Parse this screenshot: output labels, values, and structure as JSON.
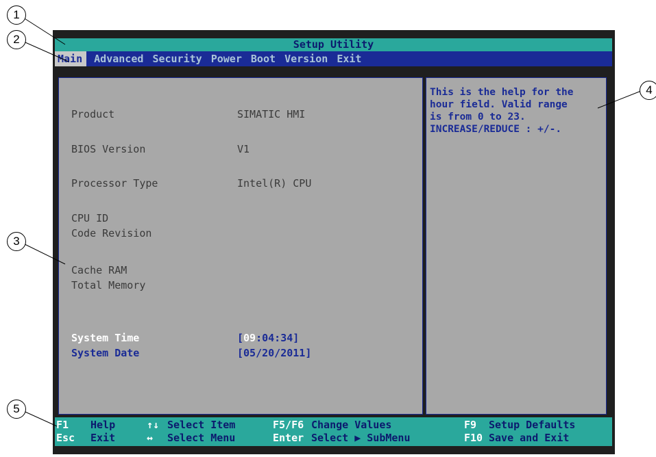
{
  "callouts": [
    "1",
    "2",
    "3",
    "4",
    "5"
  ],
  "title": "Setup Utility",
  "menu": [
    {
      "label": "Main",
      "active": true
    },
    {
      "label": "Advanced"
    },
    {
      "label": "Security"
    },
    {
      "label": "Power"
    },
    {
      "label": "Boot"
    },
    {
      "label": "Version"
    },
    {
      "label": "Exit"
    }
  ],
  "main": {
    "product_label": "Product",
    "product_value": "SIMATIC HMI",
    "bios_label": "BIOS Version",
    "bios_value": "V1",
    "processor_label": "Processor Type",
    "processor_value": "Intel(R) CPU",
    "cpu_id_label": "CPU ID",
    "code_revision_label": "Code Revision",
    "cache_ram_label": "Cache RAM",
    "total_memory_label": "Total Memory",
    "system_time_label": "System Time",
    "system_time_open": "[",
    "system_time_hour": "09",
    "system_time_rest": ":04:34]",
    "system_date_label": "System Date",
    "system_date_value": "[05/20/2011]"
  },
  "help": {
    "text": "This is the help for the\nhour field. Valid range\nis from 0 to 23.\nINCREASE/REDUCE : +/-."
  },
  "status": {
    "f1_key": "F1",
    "f1_desc": "Help",
    "esc_key": "Esc",
    "esc_desc": "Exit",
    "updown_key": "↑↓",
    "updown_desc": "Select Item",
    "leftright_key": "↔",
    "leftright_desc": "Select Menu",
    "f5f6_key": "F5/F6",
    "f5f6_desc": "Change Values",
    "enter_key": "Enter",
    "enter_desc": "Select ▶ SubMenu",
    "f9_key": "F9",
    "f9_desc": "Setup Defaults",
    "f10_key": "F10",
    "f10_desc": "Save and Exit"
  },
  "colors": {
    "title_bg": "#2aa89c",
    "menu_bg": "#1a2b96",
    "panel_bg": "#a8a8a8"
  }
}
